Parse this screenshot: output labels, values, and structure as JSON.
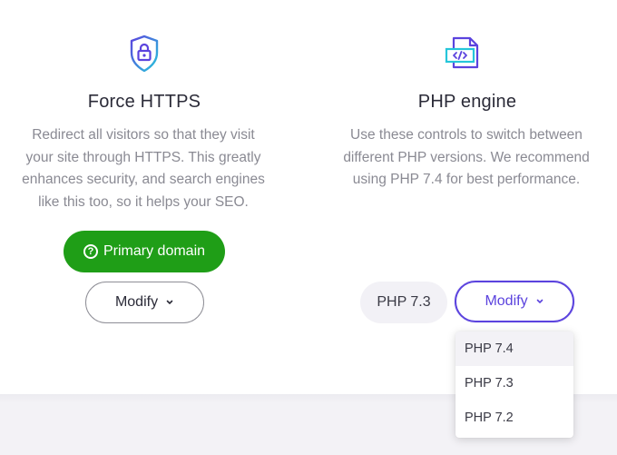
{
  "https_card": {
    "title": "Force HTTPS",
    "description_lines": [
      "Redirect all visitors so that they visit",
      "your site through HTTPS. This greatly",
      "enhances security, and search engines",
      "like this too, so it helps your SEO."
    ],
    "primary_button_label": "Primary domain",
    "primary_button_icon": "question-circle-icon",
    "modify_label": "Modify",
    "icon": "shield-lock-icon"
  },
  "php_card": {
    "title": "PHP engine",
    "description_lines": [
      "Use these controls to switch between",
      "different PHP versions. We recommend",
      "using PHP 7.4 for best performance."
    ],
    "current_version": "PHP 7.3",
    "modify_label": "Modify",
    "icon": "code-file-icon",
    "dropdown_options": [
      "PHP 7.4",
      "PHP 7.3",
      "PHP 7.2"
    ],
    "highlighted_option": "PHP 7.4"
  },
  "colors": {
    "green": "#1f9e17",
    "accent_purple": "#5b43de",
    "icon_cyan": "#26c6da",
    "muted_text": "#8a8a93"
  }
}
